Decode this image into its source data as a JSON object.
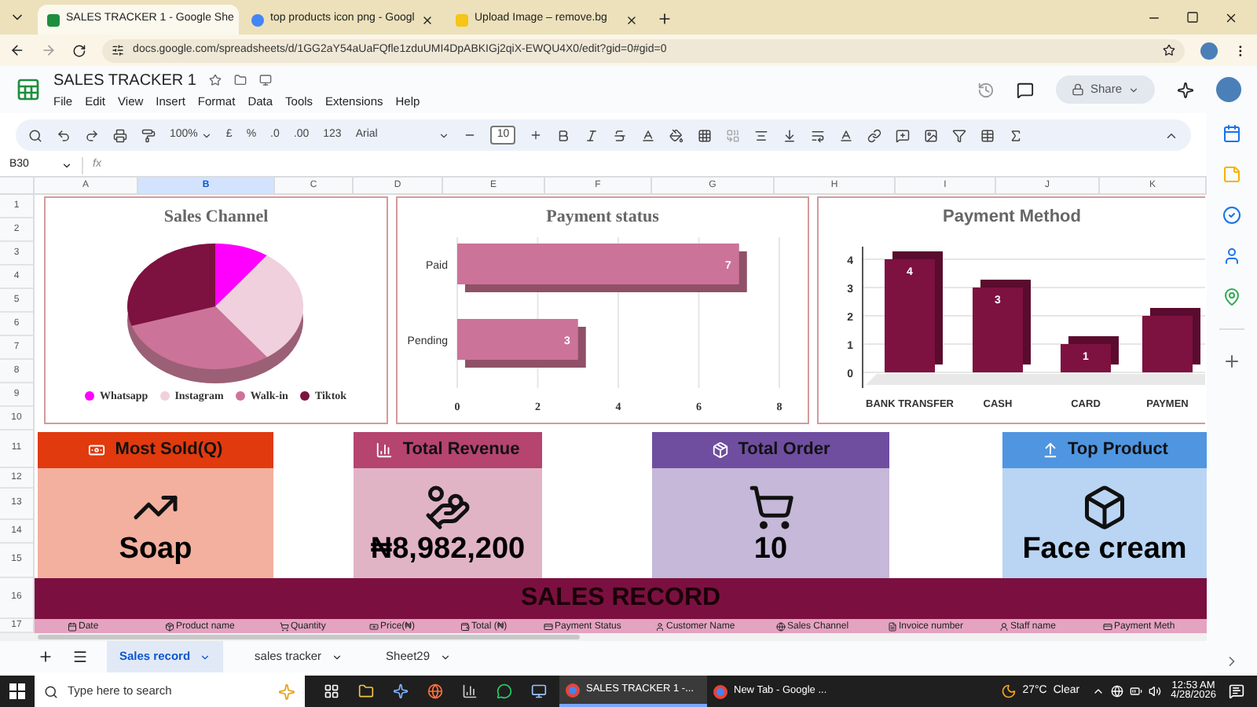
{
  "browser": {
    "tabs": [
      {
        "title": "SALES TRACKER 1 - Google She",
        "selected": true
      },
      {
        "title": "top products icon png - Googl",
        "selected": false
      },
      {
        "title": "Upload Image – remove.bg",
        "selected": false
      }
    ],
    "url": "docs.google.com/spreadsheets/d/1GG2aY54aUaFQfle1zduUMI4DpABKIGj2qiX-EWQU4X0/edit?gid=0#gid=0"
  },
  "sheets": {
    "title": "SALES TRACKER 1",
    "menu": [
      "File",
      "Edit",
      "View",
      "Insert",
      "Format",
      "Data",
      "Tools",
      "Extensions",
      "Help"
    ],
    "share": "Share",
    "toolbar": {
      "zoom": "100%",
      "currency": "£",
      "percent": "%",
      "decrease_decimals": ".0",
      "increase_decimals": ".00",
      "number_format": "123",
      "font": "Arial",
      "font_size": "10"
    },
    "name_box": "B30",
    "fx": "fx"
  },
  "grid": {
    "columns": [
      {
        "label": "A",
        "selected": false
      },
      {
        "label": "B",
        "selected": true
      },
      {
        "label": "C",
        "selected": false
      },
      {
        "label": "D",
        "selected": false
      },
      {
        "label": "E",
        "selected": false
      },
      {
        "label": "F",
        "selected": false
      },
      {
        "label": "G",
        "selected": false
      },
      {
        "label": "H",
        "selected": false
      },
      {
        "label": "I",
        "selected": false
      },
      {
        "label": "J",
        "selected": false
      },
      {
        "label": "K",
        "selected": false
      }
    ],
    "rows": [
      "1",
      "2",
      "3",
      "4",
      "5",
      "6",
      "7",
      "8",
      "9",
      "10",
      "11",
      "12",
      "13",
      "14",
      "15",
      "16",
      "17"
    ]
  },
  "sales_channel_chart": {
    "title": "Sales Channel",
    "legend": [
      {
        "label": "Whatsapp",
        "color": "#ff00ff"
      },
      {
        "label": "Instagram",
        "color": "#efd0dc"
      },
      {
        "label": "Walk-in",
        "color": "#cc7399"
      },
      {
        "label": "Tiktok",
        "color": "#7d1140"
      }
    ]
  },
  "payment_status_chart": {
    "title": "Payment status",
    "chart_data": {
      "type": "bar",
      "orientation": "horizontal",
      "categories": [
        "Paid",
        "Pending"
      ],
      "series": [
        {
          "color": "#cc7399",
          "values": [
            7,
            3
          ]
        }
      ],
      "xlim": [
        0,
        8
      ],
      "xticks": [
        0,
        2,
        4,
        6,
        8
      ],
      "data_labels": true,
      "grid": true
    }
  },
  "payment_method_chart": {
    "title": "Payment Method",
    "chart_data": {
      "type": "bar",
      "categories": [
        "BANK TRANSFER",
        "CASH",
        "CARD",
        "PAYMEN"
      ],
      "series": [
        {
          "color": "#7d1140",
          "values": [
            4,
            3,
            1,
            2
          ]
        }
      ],
      "ylim": [
        0,
        4
      ],
      "yticks": [
        0,
        1,
        2,
        3,
        4
      ],
      "value_labels": [
        "4",
        "3",
        "1",
        null
      ],
      "grid": true
    }
  },
  "kpis": [
    {
      "title": "Most Sold(Q)",
      "value": "Soap",
      "color": "#e03a0e"
    },
    {
      "title": "Total Revenue",
      "value": "₦8,982,200",
      "color": "#b5446f"
    },
    {
      "title": "Total Order",
      "value": "10",
      "color": "#6f4ea0"
    },
    {
      "title": "Top Product",
      "value": "Face cream",
      "color": "#4f95e0"
    }
  ],
  "sales_record": {
    "title": "SALES RECORD",
    "columns": [
      "Date",
      "Product name",
      "Quantity",
      "Price(₦)",
      "Total (₦)",
      "Payment Status",
      "Customer Name",
      "Sales Channel",
      "Invoice number",
      "Staff name",
      "Payment Meth"
    ]
  },
  "sheet_tabs": [
    {
      "label": "Sales record",
      "selected": true
    },
    {
      "label": "sales tracker",
      "selected": false
    },
    {
      "label": "Sheet29",
      "selected": false
    }
  ],
  "taskbar": {
    "search_placeholder": "Type here to search",
    "windows": [
      {
        "title": "SALES TRACKER 1 -...",
        "selected": true
      },
      {
        "title": "New Tab - Google ...",
        "selected": false
      }
    ],
    "temperature": "27°C",
    "condition": "Clear",
    "time": "12:53 AM",
    "date": "4/28/2026"
  }
}
